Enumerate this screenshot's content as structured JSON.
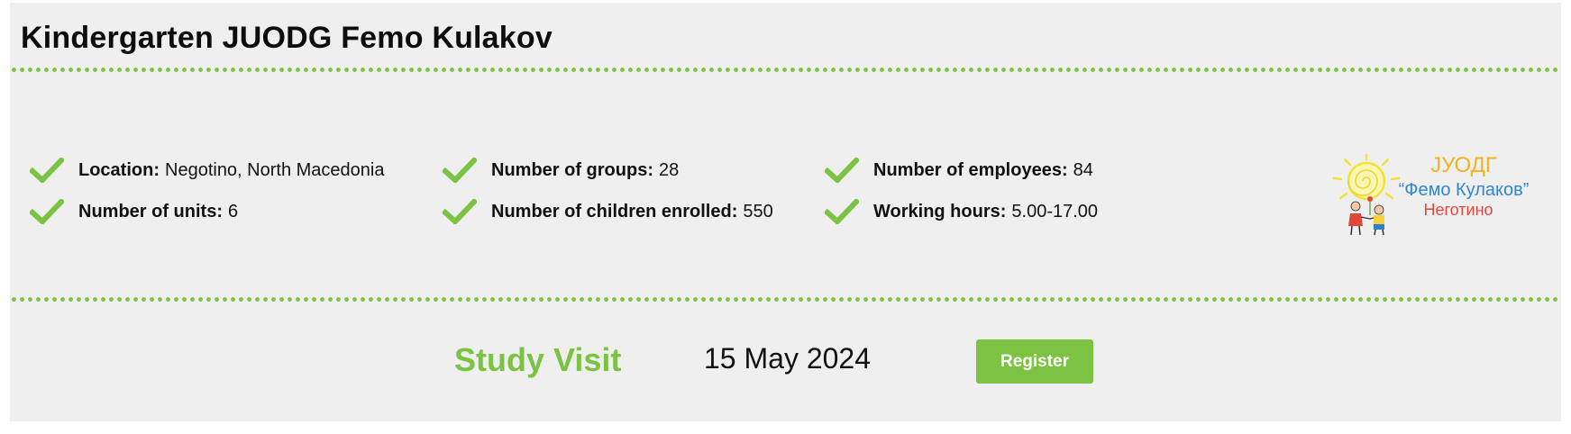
{
  "header": {
    "title": "Kindergarten JUODG Femo Kulakov"
  },
  "features": [
    {
      "label": "Location:",
      "value": "Negotino, North Macedonia"
    },
    {
      "label": "Number of groups:",
      "value": "28"
    },
    {
      "label": "Number of employees:",
      "value": "84"
    },
    {
      "label": "Number of units:",
      "value": "6"
    },
    {
      "label": "Number of children enrolled:",
      "value": "550"
    },
    {
      "label": "Working hours:",
      "value": "5.00-17.00"
    }
  ],
  "logo": {
    "line1": "ЈУОДГ",
    "line2": "“Фемо Кулаков”",
    "line3": "Неготино"
  },
  "visit": {
    "label": "Study Visit",
    "date": "15 May 2024",
    "register_label": "Register"
  },
  "colors": {
    "accent": "#7cc243",
    "background": "#efefef"
  },
  "icons": {
    "feature": "checkmark-icon"
  }
}
